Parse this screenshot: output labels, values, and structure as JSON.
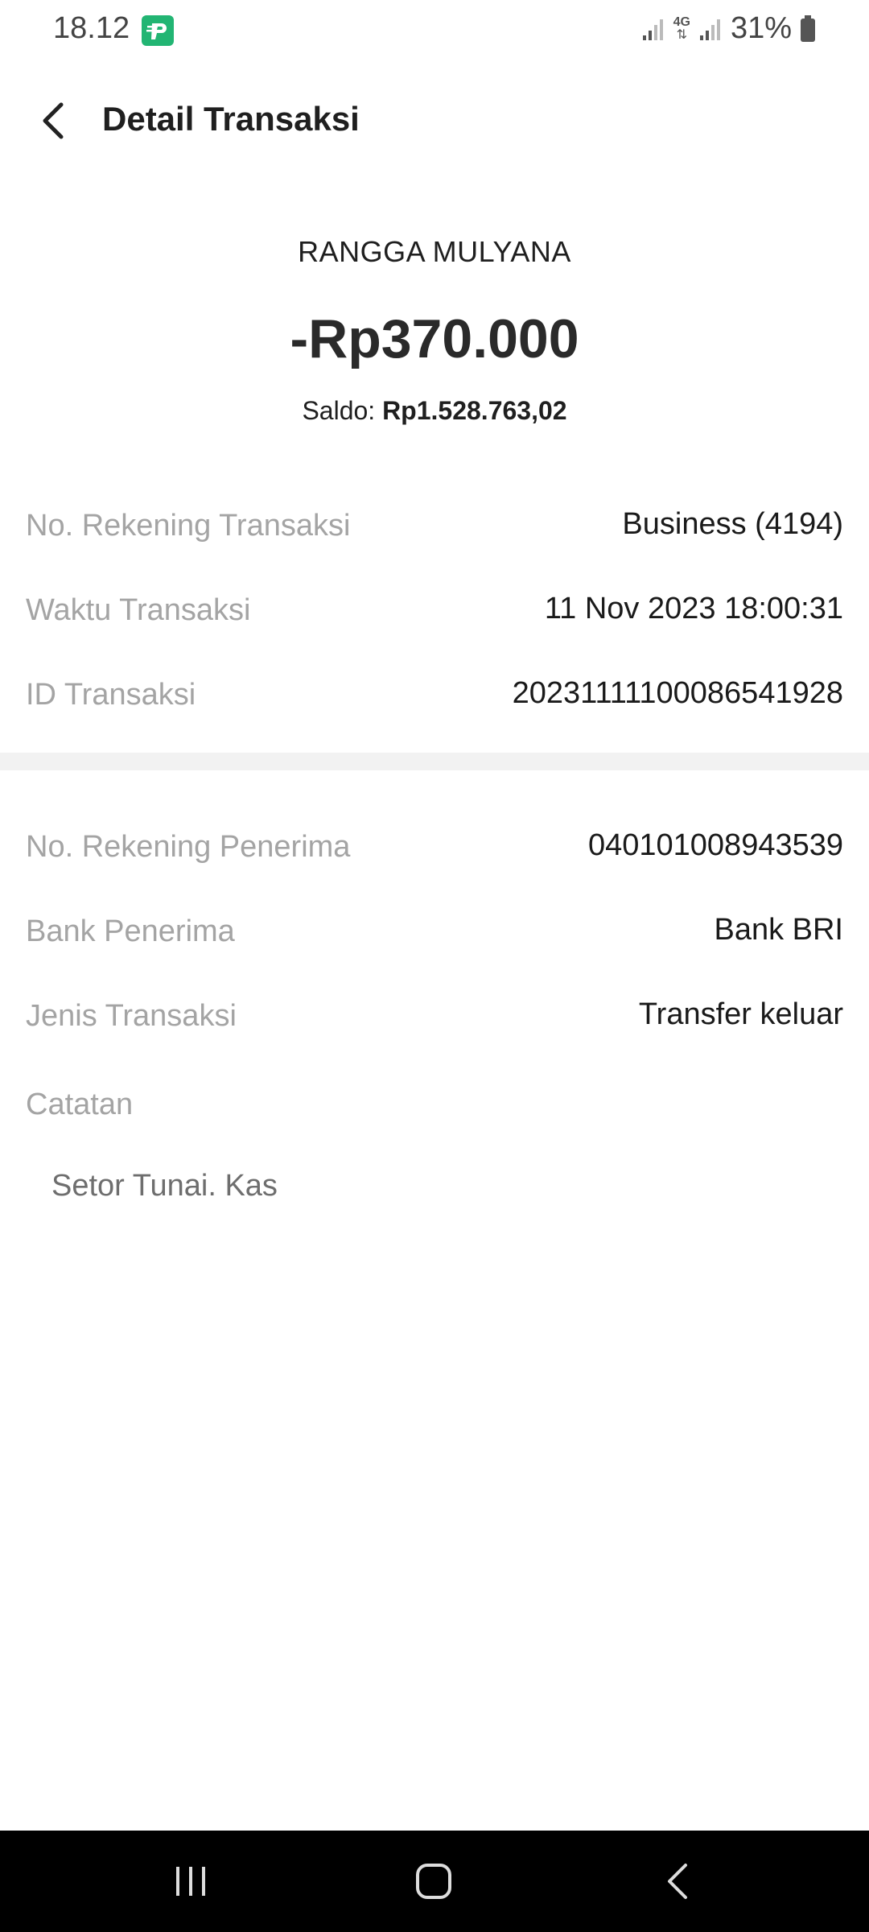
{
  "status_bar": {
    "time": "18.12",
    "network": "4G",
    "battery": "31%"
  },
  "header": {
    "title": "Detail Transaksi"
  },
  "summary": {
    "name": "RANGGA MULYANA",
    "amount": "-Rp370.000",
    "balance_label": "Saldo: ",
    "balance_value": "Rp1.528.763,02"
  },
  "details": [
    {
      "label": "No. Rekening Transaksi",
      "value": "Business (4194)"
    },
    {
      "label": "Waktu Transaksi",
      "value": "11 Nov 2023 18:00:31"
    },
    {
      "label": "ID Transaksi",
      "value": "20231111100086541928"
    }
  ],
  "recipient": [
    {
      "label": "No. Rekening Penerima",
      "value": "040101008943539"
    },
    {
      "label": "Bank Penerima",
      "value": "Bank BRI"
    },
    {
      "label": "Jenis Transaksi",
      "value": "Transfer keluar"
    }
  ],
  "note": {
    "label": "Catatan",
    "text": "Setor Tunai.  Kas"
  },
  "colors": {
    "accent": "#22b573",
    "label_gray": "#a4a4a4",
    "divider": "#f2f2f2"
  }
}
